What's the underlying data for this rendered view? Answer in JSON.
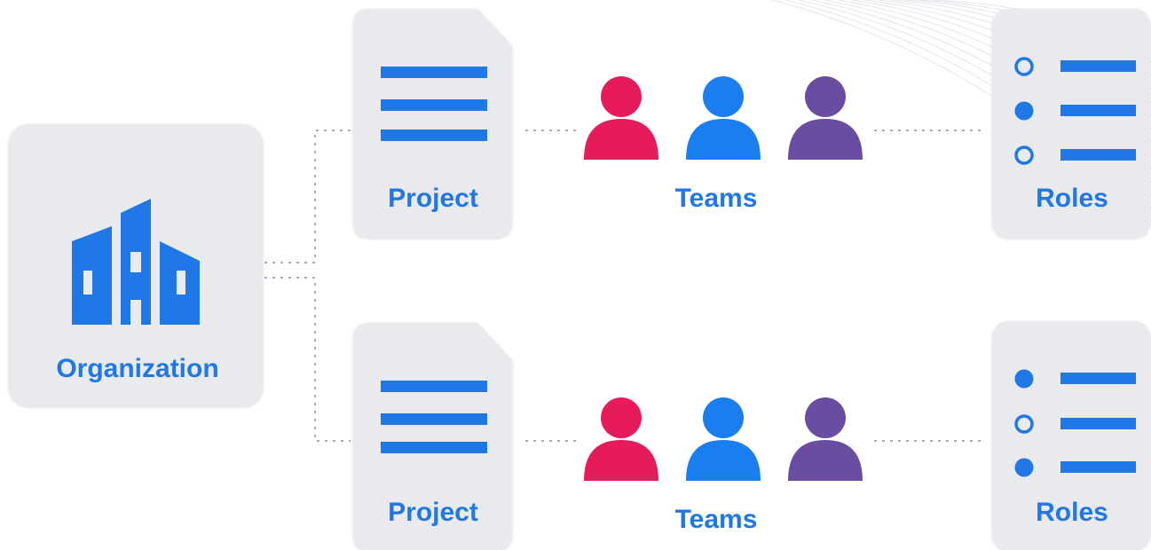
{
  "nodes": {
    "organization": {
      "label": "Organization"
    },
    "projects": [
      {
        "label": "Project"
      },
      {
        "label": "Project"
      }
    ],
    "teams": [
      {
        "label": "Teams",
        "members": [
          "pink",
          "blue",
          "purple"
        ]
      },
      {
        "label": "Teams",
        "members": [
          "pink",
          "blue",
          "purple"
        ]
      }
    ],
    "roles": [
      {
        "label": "Roles",
        "options": [
          "open",
          "filled",
          "open"
        ]
      },
      {
        "label": "Roles",
        "options": [
          "filled",
          "open",
          "filled"
        ]
      }
    ]
  },
  "colors": {
    "accent": "#1f78e5",
    "card": "#e9eaee",
    "card_shadow": "#d7d9df",
    "connector": "#8a8e96",
    "person_pink": "#e61c5a",
    "person_blue": "#1a7df0",
    "person_purple": "#6a4da0"
  }
}
